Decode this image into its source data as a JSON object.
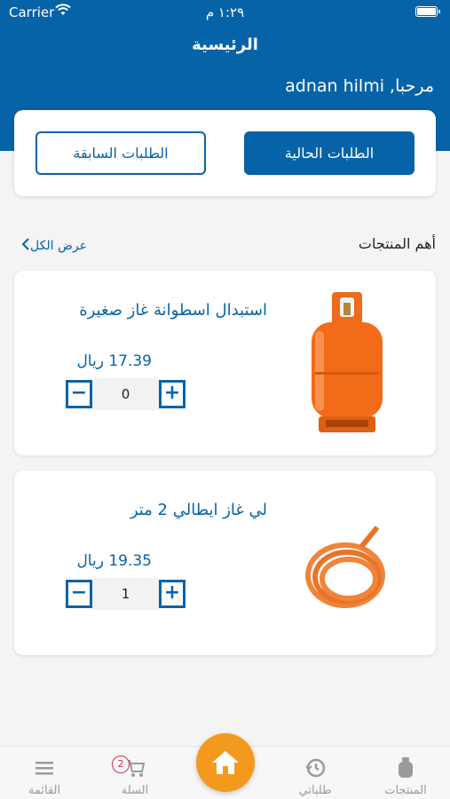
{
  "status_bar": {
    "carrier": "Carrier",
    "time": "١:٢٩ م"
  },
  "header": {
    "title": "الرئيسية",
    "greeting": "مرحبا, adnan hilmi"
  },
  "orders": {
    "current_label": "الطلبات الحالية",
    "previous_label": "الطلبات السابقة"
  },
  "section": {
    "title": "أهم المنتجات",
    "view_all": "عرض الكل"
  },
  "products": [
    {
      "name": "استبدال اسطوانة غاز صغيرة",
      "price": "17.39 ريال",
      "quantity": "0",
      "image": "gas-cylinder"
    },
    {
      "name": "لي غاز ايطالي  2 متر",
      "price": "19.35 ريال",
      "quantity": "1",
      "image": "gas-hose"
    }
  ],
  "tabs": {
    "products": "المنتجات",
    "my_orders": "طلباتي",
    "cart": "السلة",
    "cart_badge": "2",
    "menu": "القائمة"
  },
  "colors": {
    "primary": "#0763a7",
    "accent": "#f39a1e",
    "badge": "#d2334a"
  }
}
